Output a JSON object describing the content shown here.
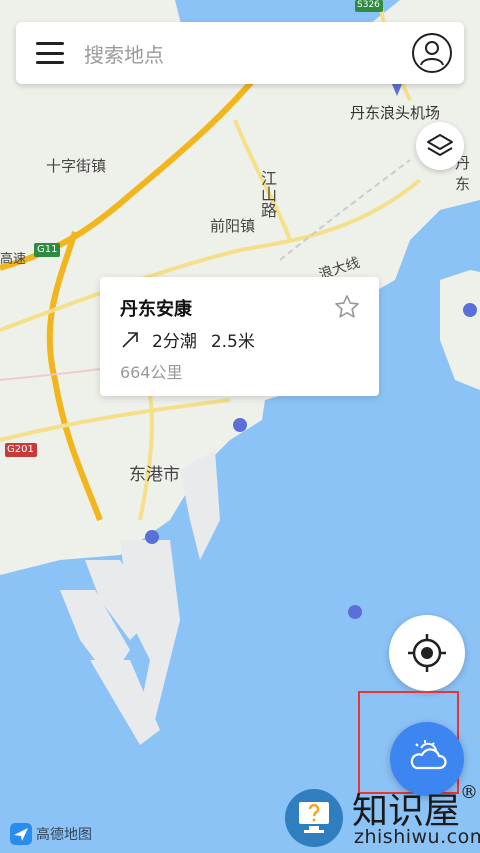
{
  "search": {
    "placeholder": "搜索地点"
  },
  "map_labels": {
    "cross_town": "十字街镇",
    "airport": "丹东浪头机场",
    "jiangshan_road": "江山路",
    "qianyang_town": "前阳镇",
    "donggang_city": "东港市",
    "east_edge": "丹东",
    "highway_west": "高速",
    "langda_line": "浪大线",
    "badge_g11": "G11",
    "badge_g201": "G201",
    "badge_s326": "S326"
  },
  "tide_card": {
    "title": "丹东安康",
    "tide_type": "2分潮",
    "tide_level": "2.5米",
    "distance": "664公里"
  },
  "footer": {
    "logo_text": "高德地图",
    "watermark_text": "知识屋",
    "watermark_reg": "®",
    "watermark_url": "zhishiwu.com"
  },
  "colors": {
    "sea": "#8cc3f7",
    "land": "#eef0ea",
    "highway": "#f2b51b",
    "accent": "#3d86f2",
    "highlight": "#e33333"
  },
  "icons": [
    "menu-icon",
    "user-icon",
    "layers-icon",
    "star-icon",
    "arrow-up-right-icon",
    "locate-icon",
    "weather-icon"
  ]
}
